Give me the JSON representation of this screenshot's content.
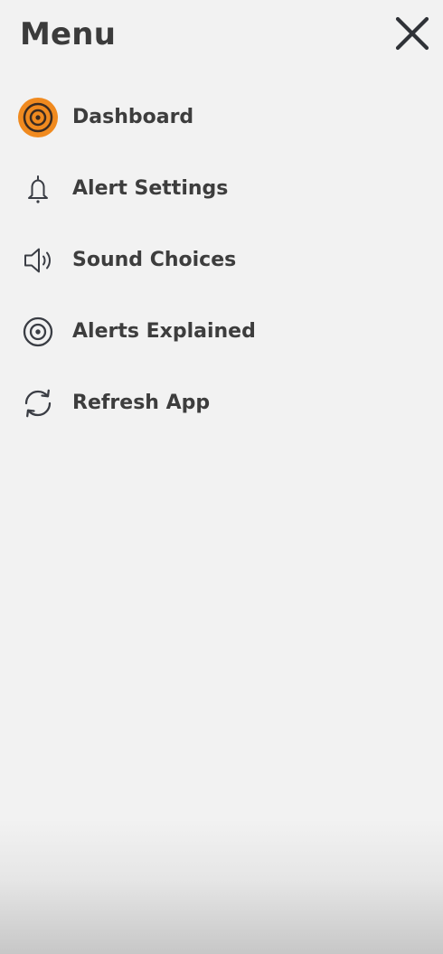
{
  "menu": {
    "title": "Menu",
    "close_icon": "close-icon",
    "items": [
      {
        "label": "Dashboard",
        "icon": "target-icon",
        "active": true
      },
      {
        "label": "Alert Settings",
        "icon": "bell-icon",
        "active": false
      },
      {
        "label": "Sound Choices",
        "icon": "speaker-icon",
        "active": false
      },
      {
        "label": "Alerts Explained",
        "icon": "target-icon",
        "active": false
      },
      {
        "label": "Refresh App",
        "icon": "refresh-icon",
        "active": false
      }
    ]
  },
  "colors": {
    "background": "#f2f2f2",
    "text": "#3d3d3d",
    "accent": "#f08a1f",
    "icon": "#3a3d44"
  }
}
